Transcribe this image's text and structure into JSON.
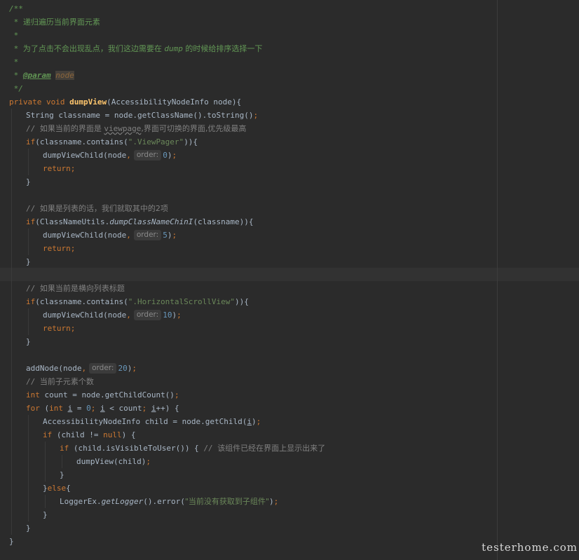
{
  "editor": {
    "language": "java",
    "colors": {
      "background": "#2b2b2b",
      "keyword": "#cc7832",
      "function": "#ffc66d",
      "comment": "#808080",
      "doc_comment": "#629755",
      "string": "#6a8759",
      "number": "#6897bb",
      "text": "#a9b7c6"
    },
    "lines": [
      {
        "indent": 0,
        "tokens": [
          {
            "t": "/**",
            "c": "doc"
          }
        ]
      },
      {
        "indent": 0,
        "tokens": [
          {
            "t": " * ",
            "c": "doc"
          },
          {
            "t": "递归遍历当前界面元素",
            "c": "doc-cn"
          }
        ]
      },
      {
        "indent": 0,
        "tokens": [
          {
            "t": " *",
            "c": "doc"
          }
        ]
      },
      {
        "indent": 0,
        "tokens": [
          {
            "t": " * ",
            "c": "doc"
          },
          {
            "t": "为了点击不会出现乱点，我们这边需要在 ",
            "c": "doc-cn"
          },
          {
            "t": "dump",
            "c": "doc"
          },
          {
            "t": " 的时候给排序选择一下",
            "c": "doc-cn"
          }
        ]
      },
      {
        "indent": 0,
        "tokens": [
          {
            "t": " *",
            "c": "doc"
          }
        ]
      },
      {
        "indent": 0,
        "tokens": [
          {
            "t": " * ",
            "c": "doc"
          },
          {
            "t": "@param",
            "c": "tag"
          },
          {
            "t": " ",
            "c": "doc"
          },
          {
            "t": "node",
            "c": "param"
          }
        ]
      },
      {
        "indent": 0,
        "tokens": [
          {
            "t": " */",
            "c": "doc"
          }
        ]
      },
      {
        "indent": 0,
        "tokens": [
          {
            "t": "private void ",
            "c": "kw"
          },
          {
            "t": "dumpView",
            "c": "fn"
          },
          {
            "t": "(AccessibilityNodeInfo node){",
            "c": ""
          }
        ]
      },
      {
        "indent": 1,
        "tokens": [
          {
            "t": "String classname = node.getClassName().toString()",
            "c": ""
          },
          {
            "t": ";",
            "c": "kw"
          }
        ]
      },
      {
        "indent": 1,
        "tokens": [
          {
            "t": "// ",
            "c": "com"
          },
          {
            "t": "如果当前的界面是 ",
            "c": "com-cn"
          },
          {
            "t": "viewpage",
            "c": "com wavy"
          },
          {
            "t": ",界面可切换的界面,优先级最高",
            "c": "com-cn"
          }
        ]
      },
      {
        "indent": 1,
        "tokens": [
          {
            "t": "if",
            "c": "kw"
          },
          {
            "t": "(classname.contains(",
            "c": ""
          },
          {
            "t": "\".ViewPager\"",
            "c": "str"
          },
          {
            "t": ")){",
            "c": ""
          }
        ]
      },
      {
        "indent": 2,
        "tokens": [
          {
            "t": "dumpViewChild(node",
            "c": ""
          },
          {
            "t": ",",
            "c": "kw"
          },
          {
            "t": "order:",
            "c": "hint"
          },
          {
            "t": "0",
            "c": "num"
          },
          {
            "t": ")",
            "c": ""
          },
          {
            "t": ";",
            "c": "kw"
          }
        ]
      },
      {
        "indent": 2,
        "tokens": [
          {
            "t": "return;",
            "c": "kw"
          }
        ]
      },
      {
        "indent": 1,
        "tokens": [
          {
            "t": "}",
            "c": ""
          }
        ]
      },
      {
        "indent": 0,
        "tokens": []
      },
      {
        "indent": 1,
        "tokens": [
          {
            "t": "// ",
            "c": "com"
          },
          {
            "t": "如果是列表的话，我们就取其中的2项",
            "c": "com-cn"
          }
        ]
      },
      {
        "indent": 1,
        "tokens": [
          {
            "t": "if",
            "c": "kw"
          },
          {
            "t": "(ClassNameUtils.",
            "c": ""
          },
          {
            "t": "dumpClassNameChinI",
            "c": "it"
          },
          {
            "t": "(classname)){",
            "c": ""
          }
        ]
      },
      {
        "indent": 2,
        "tokens": [
          {
            "t": "dumpViewChild(node",
            "c": ""
          },
          {
            "t": ",",
            "c": "kw"
          },
          {
            "t": "order:",
            "c": "hint"
          },
          {
            "t": "5",
            "c": "num"
          },
          {
            "t": ")",
            "c": ""
          },
          {
            "t": ";",
            "c": "kw"
          }
        ]
      },
      {
        "indent": 2,
        "tokens": [
          {
            "t": "return;",
            "c": "kw"
          }
        ]
      },
      {
        "indent": 1,
        "tokens": [
          {
            "t": "}",
            "c": ""
          }
        ]
      },
      {
        "indent": 0,
        "tokens": []
      },
      {
        "indent": 1,
        "tokens": [
          {
            "t": "// ",
            "c": "com"
          },
          {
            "t": "如果当前是横向列表标题",
            "c": "com-cn"
          }
        ]
      },
      {
        "indent": 1,
        "tokens": [
          {
            "t": "if",
            "c": "kw"
          },
          {
            "t": "(classname.contains(",
            "c": ""
          },
          {
            "t": "\".HorizontalScrollView\"",
            "c": "str"
          },
          {
            "t": ")){",
            "c": ""
          }
        ]
      },
      {
        "indent": 2,
        "tokens": [
          {
            "t": "dumpViewChild(node",
            "c": ""
          },
          {
            "t": ",",
            "c": "kw"
          },
          {
            "t": "order:",
            "c": "hint"
          },
          {
            "t": "10",
            "c": "num"
          },
          {
            "t": ")",
            "c": ""
          },
          {
            "t": ";",
            "c": "kw"
          }
        ]
      },
      {
        "indent": 2,
        "tokens": [
          {
            "t": "return;",
            "c": "kw"
          }
        ]
      },
      {
        "indent": 1,
        "tokens": [
          {
            "t": "}",
            "c": ""
          }
        ]
      },
      {
        "indent": 0,
        "tokens": []
      },
      {
        "indent": 1,
        "tokens": [
          {
            "t": "addNode(node",
            "c": ""
          },
          {
            "t": ",",
            "c": "kw"
          },
          {
            "t": "order:",
            "c": "hint"
          },
          {
            "t": "20",
            "c": "num"
          },
          {
            "t": ")",
            "c": ""
          },
          {
            "t": ";",
            "c": "kw"
          }
        ]
      },
      {
        "indent": 1,
        "tokens": [
          {
            "t": "// ",
            "c": "com"
          },
          {
            "t": "当前子元素个数",
            "c": "com-cn"
          }
        ]
      },
      {
        "indent": 1,
        "tokens": [
          {
            "t": "int ",
            "c": "kw"
          },
          {
            "t": "count = node.getChildCount()",
            "c": ""
          },
          {
            "t": ";",
            "c": "kw"
          }
        ]
      },
      {
        "indent": 1,
        "tokens": [
          {
            "t": "for ",
            "c": "kw"
          },
          {
            "t": "(",
            "c": ""
          },
          {
            "t": "int ",
            "c": "kw"
          },
          {
            "t": "i",
            "c": "under"
          },
          {
            "t": " = ",
            "c": ""
          },
          {
            "t": "0",
            "c": "num"
          },
          {
            "t": "; ",
            "c": "kw"
          },
          {
            "t": "i",
            "c": "under"
          },
          {
            "t": " < count",
            "c": ""
          },
          {
            "t": "; ",
            "c": "kw"
          },
          {
            "t": "i",
            "c": "under"
          },
          {
            "t": "++) {",
            "c": ""
          }
        ]
      },
      {
        "indent": 2,
        "tokens": [
          {
            "t": "AccessibilityNodeInfo child = node.getChild(",
            "c": ""
          },
          {
            "t": "i",
            "c": "under"
          },
          {
            "t": ")",
            "c": ""
          },
          {
            "t": ";",
            "c": "kw"
          }
        ]
      },
      {
        "indent": 2,
        "tokens": [
          {
            "t": "if ",
            "c": "kw"
          },
          {
            "t": "(child != ",
            "c": ""
          },
          {
            "t": "null",
            "c": "kw"
          },
          {
            "t": ") {",
            "c": ""
          }
        ]
      },
      {
        "indent": 3,
        "tokens": [
          {
            "t": "if ",
            "c": "kw"
          },
          {
            "t": "(child.isVisibleToUser()) { ",
            "c": ""
          },
          {
            "t": "// ",
            "c": "com"
          },
          {
            "t": "该组件已经在界面上显示出来了",
            "c": "com-cn"
          }
        ]
      },
      {
        "indent": 4,
        "tokens": [
          {
            "t": "dumpView(child)",
            "c": ""
          },
          {
            "t": ";",
            "c": "kw"
          }
        ]
      },
      {
        "indent": 3,
        "tokens": [
          {
            "t": "}",
            "c": ""
          }
        ]
      },
      {
        "indent": 2,
        "tokens": [
          {
            "t": "}",
            "c": ""
          },
          {
            "t": "else",
            "c": "kw"
          },
          {
            "t": "{",
            "c": ""
          }
        ]
      },
      {
        "indent": 3,
        "tokens": [
          {
            "t": "LoggerEx.",
            "c": ""
          },
          {
            "t": "getLogger",
            "c": "it"
          },
          {
            "t": "().error(",
            "c": ""
          },
          {
            "t": "\"当前没有获取到子组件\"",
            "c": "str-cn"
          },
          {
            "t": ")",
            "c": ""
          },
          {
            "t": ";",
            "c": "kw"
          }
        ]
      },
      {
        "indent": 2,
        "tokens": [
          {
            "t": "}",
            "c": ""
          }
        ]
      },
      {
        "indent": 1,
        "tokens": [
          {
            "t": "}",
            "c": ""
          }
        ]
      },
      {
        "indent": 0,
        "tokens": [
          {
            "t": "}",
            "c": ""
          }
        ]
      }
    ]
  },
  "watermark": "testerhome.com"
}
